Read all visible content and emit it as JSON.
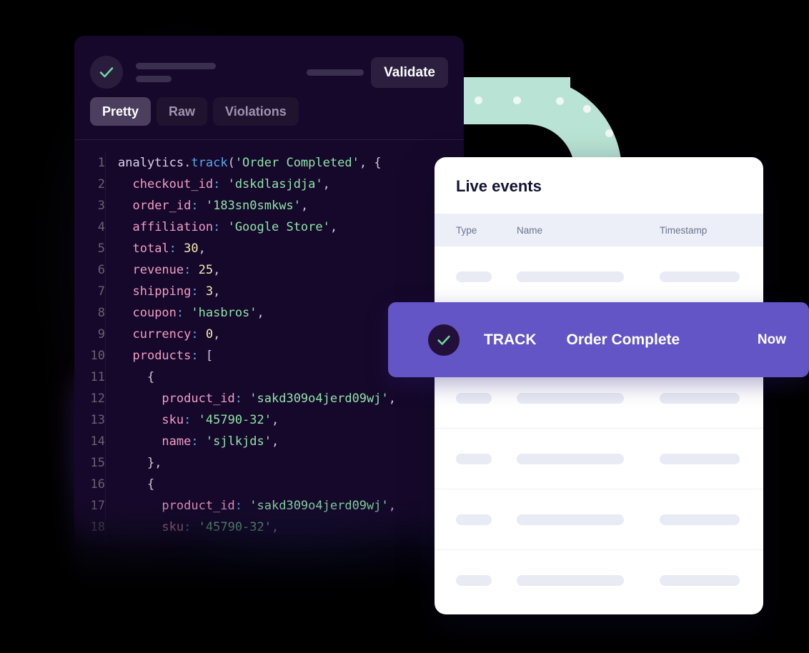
{
  "colors": {
    "background": "#000000",
    "code_panel_bg": "#16082a",
    "accent_purple": "#6355c5",
    "accent_green": "#8fe3a8",
    "pipe_green": "#b9e3d4",
    "card_bg": "#ffffff",
    "table_header_bg": "#eceff7",
    "skeleton": "#e8eaf4"
  },
  "code_panel": {
    "status_icon": "check-icon",
    "validate_label": "Validate",
    "tabs": [
      {
        "label": "Pretty",
        "active": true
      },
      {
        "label": "Raw",
        "active": false
      },
      {
        "label": "Violations",
        "active": false
      }
    ],
    "editor": {
      "line_numbers": [
        "1",
        "2",
        "3",
        "4",
        "5",
        "6",
        "7",
        "8",
        "9",
        "10",
        "11",
        "12",
        "13",
        "14",
        "15",
        "16",
        "17",
        "18"
      ],
      "lines": [
        "analytics.track('Order Completed', {",
        "  checkout_id: 'dskdlasjdja',",
        "  order_id: '183sn0smkws',",
        "  affiliation: 'Google Store',",
        "  total: 30,",
        "  revenue: 25,",
        "  shipping: 3,",
        "  coupon: 'hasbros',",
        "  currency: 0,",
        "  products: [",
        "    {",
        "      product_id: 'sakd309o4jerd09wj',",
        "      sku: '45790-32',",
        "      name: 'sjlkjds',",
        "    },",
        "    {",
        "      product_id: 'sakd309o4jerd09wj',",
        "      sku: '45790-32',"
      ]
    }
  },
  "live_events": {
    "title": "Live events",
    "columns": [
      "Type",
      "Name",
      "Timestamp"
    ],
    "rows": [
      {
        "type": "",
        "name": "",
        "timestamp": ""
      },
      {
        "type": "",
        "name": "",
        "timestamp": ""
      },
      {
        "type": "",
        "name": "",
        "timestamp": ""
      },
      {
        "type": "",
        "name": "",
        "timestamp": ""
      },
      {
        "type": "",
        "name": "",
        "timestamp": ""
      },
      {
        "type": "",
        "name": "",
        "timestamp": ""
      }
    ]
  },
  "track_banner": {
    "icon": "check-icon",
    "kind": "TRACK",
    "event_name": "Order Complete",
    "time": "Now"
  }
}
